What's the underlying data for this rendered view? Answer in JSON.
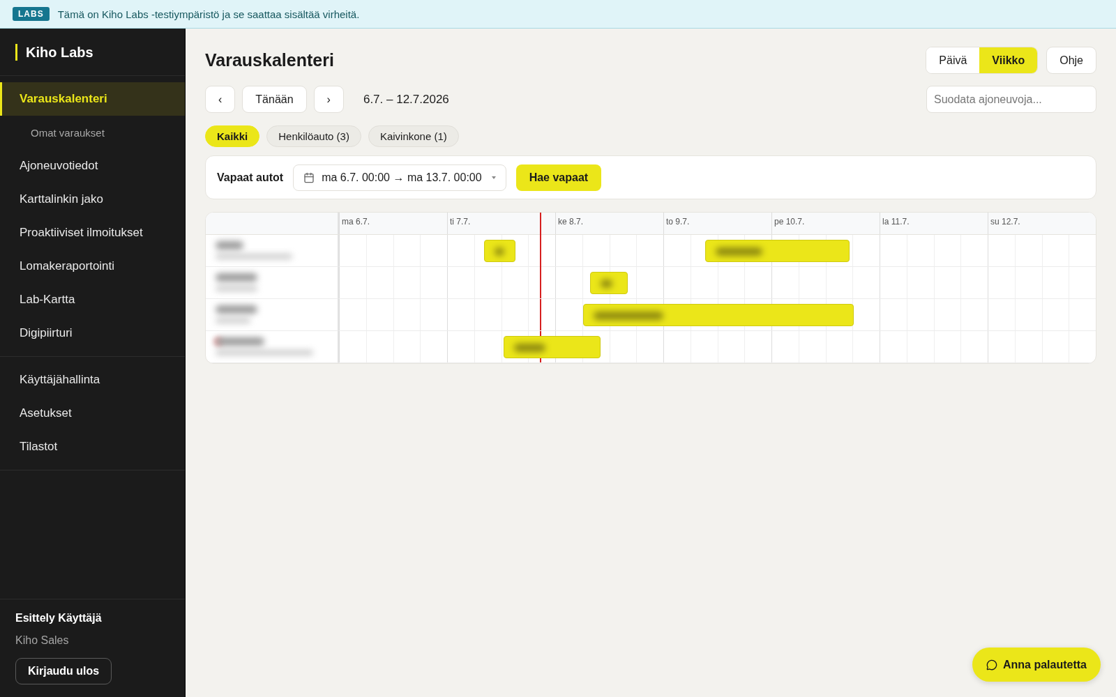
{
  "banner": {
    "badge": "LABS",
    "text": "Tämä on Kiho Labs -testiympäristö ja se saattaa sisältää virheitä."
  },
  "sidebar": {
    "brand": "Kiho Labs",
    "groups": [
      [
        {
          "label": "Varauskalenteri",
          "selected": true,
          "sub": false
        },
        {
          "label": "Omat varaukset",
          "selected": false,
          "sub": true
        },
        {
          "label": "Ajoneuvotiedot",
          "selected": false,
          "sub": false
        },
        {
          "label": "Karttalinkin jako",
          "selected": false,
          "sub": false
        },
        {
          "label": "Proaktiiviset ilmoitukset",
          "selected": false,
          "sub": false
        },
        {
          "label": "Lomakeraportointi",
          "selected": false,
          "sub": false
        },
        {
          "label": "Lab-Kartta",
          "selected": false,
          "sub": false
        },
        {
          "label": "Digipiirturi",
          "selected": false,
          "sub": false
        }
      ],
      [
        {
          "label": "Käyttäjähallinta",
          "selected": false,
          "sub": false
        },
        {
          "label": "Asetukset",
          "selected": false,
          "sub": false
        },
        {
          "label": "Tilastot",
          "selected": false,
          "sub": false
        }
      ]
    ],
    "user": {
      "name": "Esittely Käyttäjä",
      "org": "Kiho Sales",
      "logout": "Kirjaudu ulos"
    }
  },
  "page": {
    "title": "Varauskalenteri",
    "views": [
      {
        "label": "Päivä",
        "selected": false
      },
      {
        "label": "Viikko",
        "selected": true
      }
    ],
    "help": "Ohje",
    "prev": "‹",
    "today": "Tänään",
    "next": "›",
    "range": "6.7. – 12.7.2026",
    "filter": {
      "placeholder": "Suodata ajoneuvoja..."
    },
    "chips": [
      {
        "label": "Kaikki",
        "selected": true
      },
      {
        "label": "Henkilöauto (3)",
        "selected": false
      },
      {
        "label": "Kaivinkone (1)",
        "selected": false
      }
    ],
    "availability": {
      "label": "Vapaat autot",
      "range": "ma 6.7. 00:00 → ma 13.7. 00:00",
      "button": "Hae vapaat"
    }
  },
  "calendar": {
    "days": [
      "ma 6.7.",
      "ti 7.7.",
      "ke 8.7.",
      "to 9.7.",
      "pe 10.7.",
      "la 11.7.",
      "su 12.7."
    ],
    "rows": [
      {
        "status_dot": false,
        "bookings": [
          {
            "kind": "booking"
          },
          {
            "kind": "booking"
          }
        ]
      },
      {
        "status_dot": false,
        "bookings": [
          {
            "kind": "booking"
          }
        ]
      },
      {
        "status_dot": false,
        "bookings": [
          {
            "kind": "booking"
          }
        ]
      },
      {
        "status_dot": true,
        "bookings": [
          {
            "kind": "booking"
          }
        ]
      }
    ]
  },
  "feedback": {
    "label": "Anna palautetta"
  }
}
